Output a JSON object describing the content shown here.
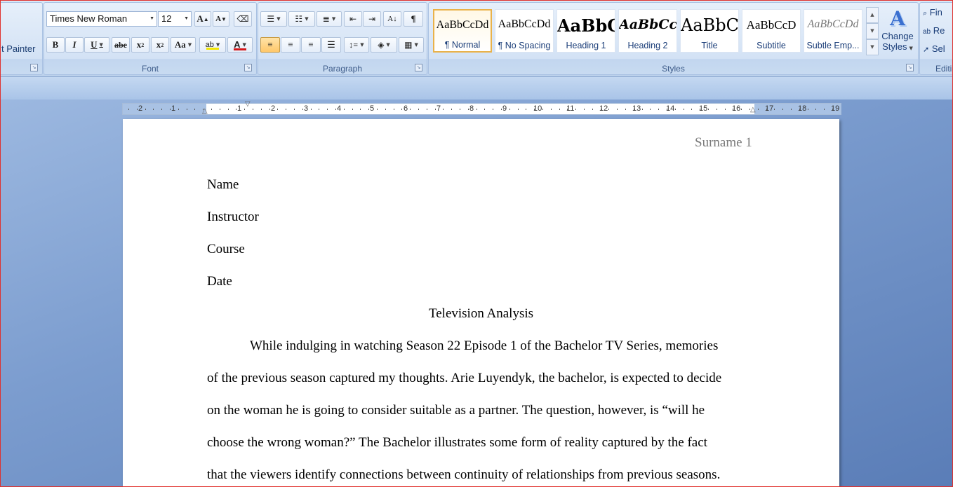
{
  "clipboard": {
    "format_painter_label": "t Painter"
  },
  "font": {
    "group_label": "Font",
    "family": "Times New Roman",
    "size": "12",
    "grow_glyph": "A",
    "shrink_glyph": "A",
    "bold": "B",
    "italic": "I",
    "underline": "U",
    "strike": "abe",
    "subscript": "x",
    "superscript": "x",
    "case": "Aa",
    "highlight_glyph": "ab",
    "font_color_glyph": "A",
    "highlight_color": "#f2e600",
    "font_color": "#d4171b"
  },
  "paragraph": {
    "group_label": "Paragraph",
    "pilcrow": "¶"
  },
  "styles": {
    "group_label": "Styles",
    "items": [
      {
        "sample": "AaBbCcDd",
        "name": "¶ Normal"
      },
      {
        "sample": "AaBbCcDd",
        "name": "¶ No Spacing"
      },
      {
        "sample": "AaBbC",
        "name": "Heading 1"
      },
      {
        "sample": "AaBbCc",
        "name": "Heading 2"
      },
      {
        "sample": "AaBbC",
        "name": "Title"
      },
      {
        "sample": "AaBbCcD",
        "name": "Subtitle"
      },
      {
        "sample": "AaBbCcDd",
        "name": "Subtle Emp..."
      }
    ],
    "change_styles_line1": "Change",
    "change_styles_line2": "Styles"
  },
  "editing": {
    "group_label": "Editi",
    "find": "Fin",
    "replace": "Re",
    "select": "Sel"
  },
  "ruler": {
    "left_numbers": [
      "2",
      "1"
    ],
    "right_numbers": [
      "1",
      "2",
      "3",
      "4",
      "5",
      "6",
      "7",
      "8",
      "9",
      "10",
      "11",
      "12",
      "13",
      "14",
      "15",
      "16",
      "17",
      "18",
      "19"
    ]
  },
  "document": {
    "header": "Surname 1",
    "lines": [
      "Name",
      "Instructor",
      "Course",
      "Date"
    ],
    "title": "Television Analysis",
    "body": [
      "While indulging in watching Season 22 Episode 1 of the Bachelor TV Series, memories",
      "of the previous season captured my thoughts. Arie Luyendyk, the bachelor, is expected to decide",
      "on the woman he is going to consider suitable as a partner. The question, however, is “will he",
      "choose the wrong woman?” The Bachelor illustrates some form of reality captured by the fact",
      "that the viewers identify connections between continuity of relationships from previous seasons."
    ]
  }
}
